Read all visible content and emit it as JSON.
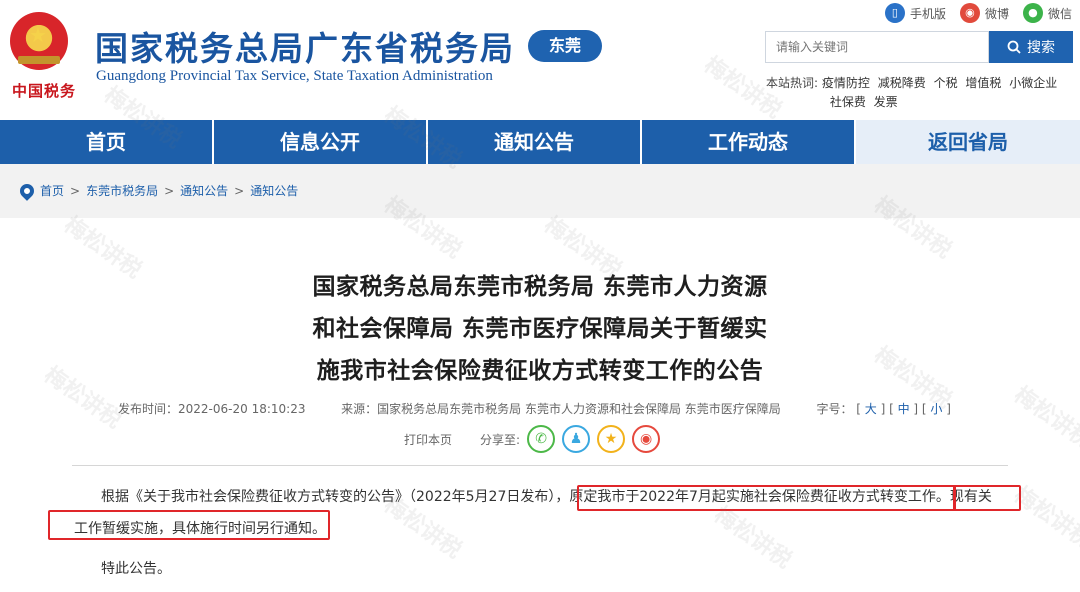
{
  "header": {
    "emblem_caption": "中国税务",
    "title": "国家税务总局广东省税务局",
    "subtitle": "Guangdong Provincial Tax Service, State Taxation Administration",
    "city_badge": "东莞",
    "top_links": [
      {
        "label": "手机版",
        "icon": "mobile-icon"
      },
      {
        "label": "微博",
        "icon": "weibo-icon"
      },
      {
        "label": "微信",
        "icon": "wechat-icon"
      }
    ],
    "search": {
      "placeholder": "请输入关键词",
      "button": "搜索"
    },
    "hot_words_label": "本站热词:",
    "hot_words": [
      "疫情防控",
      "减税降费",
      "个税",
      "增值税",
      "小微企业",
      "社保费",
      "发票"
    ]
  },
  "nav": [
    "首页",
    "信息公开",
    "通知公告",
    "工作动态",
    "返回省局"
  ],
  "breadcrumb": [
    "首页",
    "东莞市税务局",
    "通知公告",
    "通知公告"
  ],
  "article": {
    "title_lines": [
      "国家税务总局东莞市税务局 东莞市人力资源",
      "和社会保障局 东莞市医疗保障局关于暂缓实",
      "施我市社会保险费征收方式转变工作的公告"
    ],
    "publish_label": "发布时间：",
    "publish_time": "2022-06-20 18:10:23",
    "source_label": "来源：",
    "source": "国家税务总局东莞市税务局 东莞市人力资源和社会保障局 东莞市医疗保障局",
    "font_label": "字号：",
    "font_sizes": [
      "大",
      "中",
      "小"
    ],
    "print": "打印本页",
    "share_label": "分享至:",
    "share_icons": [
      "wechat-icon",
      "qq-icon",
      "qzone-star-icon",
      "weibo-icon"
    ],
    "para1_a": "根据《关于我市社会保险费征收方式转变的公告》（2022年5月27日发布），",
    "para1_b": "原定我市于2022年7月起实施社会保险费征收方式转变工作。",
    "para1_c": "现有关",
    "para2": "工作暂缓实施，具体施行时间另行通知。",
    "para3": "特此公告。"
  },
  "watermark_text": "梅松讲税",
  "colors": {
    "brand_blue": "#1d5faa",
    "highlight_red": "#e0262a",
    "emblem_red": "#d8252a"
  }
}
